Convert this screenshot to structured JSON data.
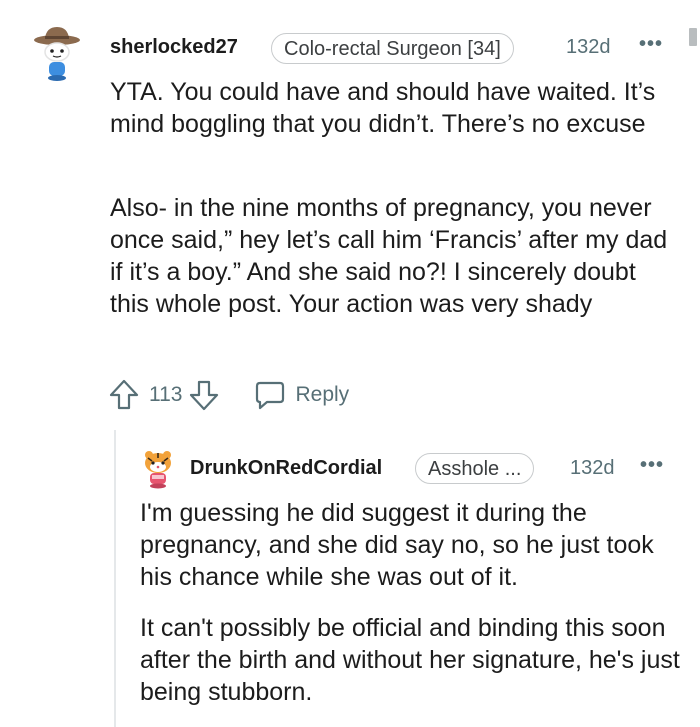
{
  "comment": {
    "username": "sherlocked27",
    "flair": "Colo-rectal Surgeon [34]",
    "age": "132d",
    "more": "•••",
    "paragraph1": "YTA. You could have and should have waited. It’s mind boggling that you didn’t. There’s no excuse",
    "paragraph2": "Also- in the nine months of pregnancy, you never once said,” hey let’s call him ‘Francis’ after my dad if it’s a boy.” And she said no?! I sincerely doubt this whole post. Your action was very shady",
    "votes": "113",
    "reply_label": "Reply"
  },
  "reply": {
    "username": "DrunkOnRedCordial",
    "flair": "Asshole ...",
    "age": "132d",
    "more": "•••",
    "paragraph1": "I'm guessing he did suggest it during the pregnancy, and she did say no, so he just took his chance while she was out of it.",
    "paragraph2": "It can't possibly be official and binding this soon after the birth and without her signature, he's just being stubborn."
  },
  "colors": {
    "meta_gray": "#576f76",
    "text": "#1c1c1c",
    "border": "#c8cbcd"
  },
  "icons": {
    "avatar_main": "cowboy-snoo-avatar",
    "avatar_reply": "tiger-snoo-avatar",
    "upvote": "upvote-arrow-icon",
    "downvote": "downvote-arrow-icon",
    "reply": "speech-bubble-icon",
    "more": "more-options-icon"
  }
}
